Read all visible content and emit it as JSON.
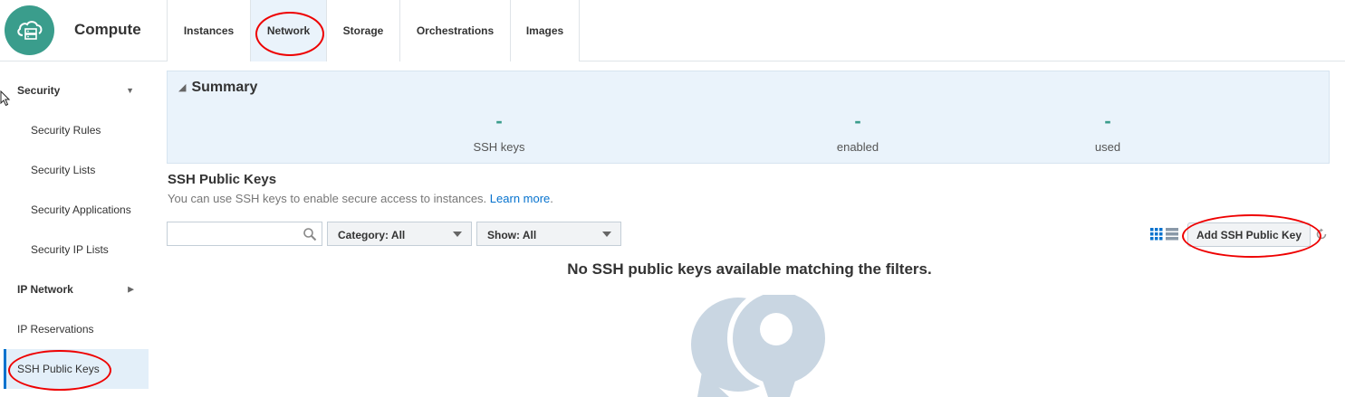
{
  "app": {
    "title": "Compute",
    "logo_icon": "cloud-server-icon"
  },
  "tabs": [
    {
      "label": "Instances",
      "active": false
    },
    {
      "label": "Network",
      "active": true
    },
    {
      "label": "Storage",
      "active": false
    },
    {
      "label": "Orchestrations",
      "active": false
    },
    {
      "label": "Images",
      "active": false
    }
  ],
  "sidebar": {
    "security_group": "Security",
    "security_rules": "Security Rules",
    "security_lists": "Security Lists",
    "security_applications": "Security Applications",
    "security_ip_lists": "Security IP Lists",
    "ip_network_group": "IP Network",
    "ip_reservations": "IP Reservations",
    "ssh_public_keys": "SSH Public Keys"
  },
  "summary": {
    "title": "Summary",
    "metrics": [
      {
        "value": "-",
        "caption": "SSH keys"
      },
      {
        "value": "-",
        "caption": "enabled"
      },
      {
        "value": "-",
        "caption": "used"
      }
    ]
  },
  "section": {
    "title": "SSH Public Keys",
    "description": "You can use SSH keys to enable secure access to instances.",
    "learn_more": "Learn more",
    "period": "."
  },
  "filters": {
    "search_value": "",
    "category": "Category: All",
    "show": "Show: All"
  },
  "toolbar": {
    "add_button": "Add SSH Public Key"
  },
  "empty_state": {
    "message": "No SSH public keys available matching the filters."
  },
  "colors": {
    "accent_teal": "#3a9d8c",
    "link_blue": "#0572ce",
    "annotation_red": "#ee0000",
    "summary_bg": "#eaf3fb"
  }
}
